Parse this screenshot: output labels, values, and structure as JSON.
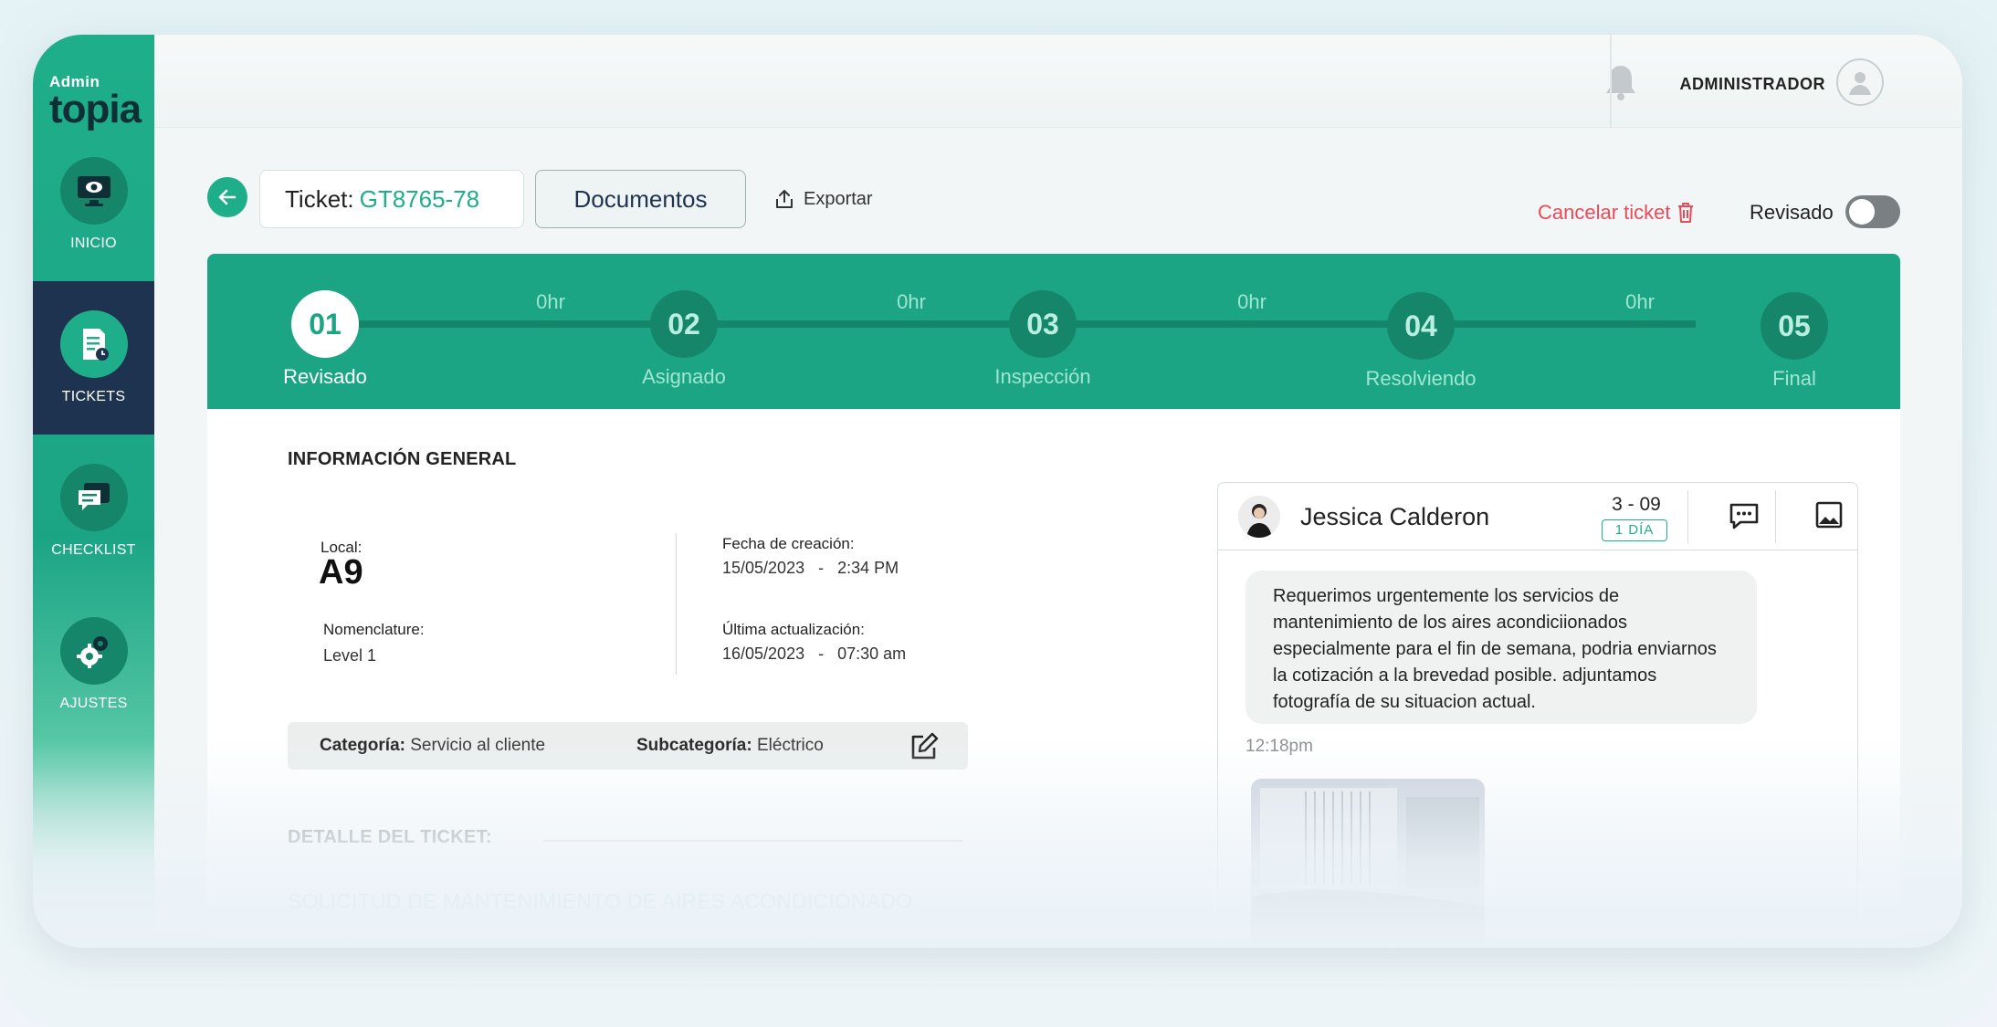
{
  "brand": {
    "small": "Admin",
    "big": "topia"
  },
  "sidebar": {
    "items": [
      {
        "label": "INICIO",
        "icon": "monitor-icon"
      },
      {
        "label": "TICKETS",
        "icon": "ticket-icon",
        "active": true
      },
      {
        "label": "CHECKLIST",
        "icon": "checklist-icon"
      },
      {
        "label": "AJUSTES",
        "icon": "gear-icon"
      }
    ]
  },
  "topbar": {
    "user": "ADMINISTRADOR"
  },
  "header": {
    "ticket_prefix": "Ticket:",
    "ticket_code": "GT8765-78",
    "documents": "Documentos",
    "export": "Exportar",
    "cancel": "Cancelar ticket",
    "reviewed_label": "Revisado",
    "reviewed_on": false
  },
  "stepper": {
    "steps": [
      {
        "num": "01",
        "label": "Revisado"
      },
      {
        "num": "02",
        "label": "Asignado"
      },
      {
        "num": "03",
        "label": "Inspección"
      },
      {
        "num": "04",
        "label": "Resolviendo"
      },
      {
        "num": "05",
        "label": "Final"
      }
    ],
    "durations": [
      "0hr",
      "0hr",
      "0hr",
      "0hr"
    ]
  },
  "info": {
    "title": "INFORMACIÓN GENERAL",
    "local_label": "Local:",
    "local_value": "A9",
    "nomenclature_label": "Nomenclature:",
    "nomenclature_value": "Level 1",
    "created_label": "Fecha de creación:",
    "created_value": "15/05/2023   -   2:34 PM",
    "updated_label": "Última actualización:",
    "updated_value": "16/05/2023   -   07:30 am",
    "category_label": "Categoría:",
    "category_value": "Servicio al cliente",
    "subcategory_label": "Subcategoría:",
    "subcategory_value": "Eléctrico",
    "detail_title": "DETALLE DEL TICKET:",
    "detail_subject": "SOLICITUD DE MANTENIMIENTO DE AIRES ACONDICIONADO"
  },
  "chat": {
    "name": "Jessica Calderon",
    "date": "3 - 09",
    "badge": "1 DÍA",
    "message": "Requerimos urgentemente los servicios de mantenimiento de los aires acondiciionados especialmente para el fin de semana, podria enviarnos la cotización a la brevedad posible. adjuntamos fotografía de su situacion actual.",
    "time": "12:18pm"
  },
  "colors": {
    "accent": "#1fae8a",
    "navy": "#1e3350",
    "danger": "#e94b59"
  }
}
